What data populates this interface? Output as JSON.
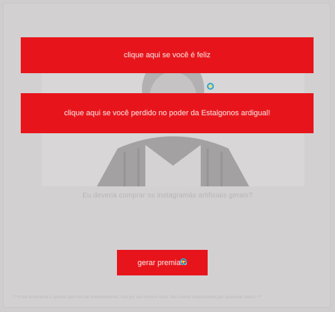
{
  "buttons": {
    "happy": "clique aqui se você é feliz",
    "power": "clique aqui se você perdido no poder da Estalgonos ardigual!",
    "generate": "gerar premiato"
  },
  "question": "Eu deveria comprar os instagramás artificiais gerais?",
  "footer": "***Esta ferramenta é apenas para fins de entretenimento. Use por sua conta e risco. Não somos responsáveis por quaisquer danos.***",
  "colors": {
    "accent": "#e8141b",
    "background": "#cfcdce"
  }
}
